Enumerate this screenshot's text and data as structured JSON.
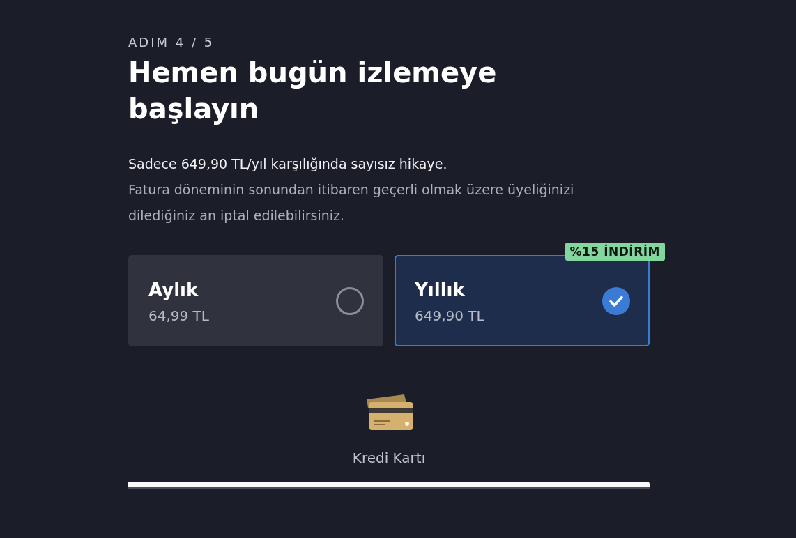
{
  "step": "ADIM 4 / 5",
  "title": "Hemen bugün izlemeye başlayın",
  "summary": "Sadece 649,90 TL/yıl karşılığında sayısız hikaye.",
  "note": "Fatura döneminin sonundan itibaren geçerli olmak üzere üyeliğinizi dilediğiniz an iptal edilebilirsiniz.",
  "plans": [
    {
      "name": "Aylık",
      "price": "64,99 TL",
      "selected": false
    },
    {
      "name": "Yıllık",
      "price": "649,90 TL",
      "selected": true,
      "badge": "%15 İNDİRİM"
    }
  ],
  "payment_methods": [
    {
      "label": "Kredi Kartı",
      "selected": true
    }
  ]
}
